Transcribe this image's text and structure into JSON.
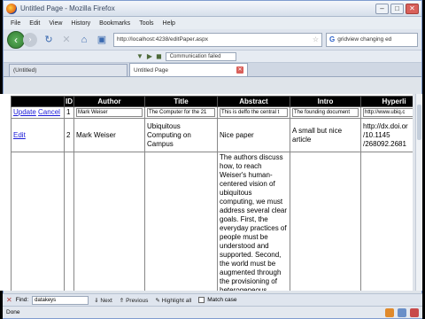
{
  "window": {
    "title": "Untitled Page - Mozilla Firefox"
  },
  "menu": [
    "File",
    "Edit",
    "View",
    "History",
    "Bookmarks",
    "Tools",
    "Help"
  ],
  "nav": {
    "url": "http://localhost:4238/editPaper.aspx",
    "search_text": "gridview changing ed",
    "status_box": "Communication failed"
  },
  "tabs": [
    {
      "label": "(Untitled)"
    },
    {
      "label": "Untitled Page"
    }
  ],
  "table": {
    "headers": [
      "",
      "ID",
      "Author",
      "Title",
      "Abstract",
      "Intro",
      "Hyperli"
    ],
    "edit_row": {
      "update_label": "Update",
      "cancel_label": "Cancel",
      "id": "1",
      "author": "Mark Weiser",
      "title": "The Computer for the 21",
      "abstract": "This is deffo the central t",
      "intro": "The founding document",
      "hyperlink": "http://www.ubiq.c"
    },
    "row2": {
      "edit_label": "Edit",
      "id": "2",
      "author": "Mark Weiser",
      "title": "Ubiquitous Computing on Campus",
      "abstract": "Nice paper",
      "intro": "A small but nice article",
      "hyperlink": "http://dx.doi.or /10.1145 /268092.2681"
    },
    "row3": {
      "abstract": "The authors discuss how, to reach Weiser's human-centered vision of ubiquitous computing, we must address several clear goals. First, the everyday practices of people must be understood and supported. Second, the world must be augmented through the provisioning of heterogeneous"
    }
  },
  "find": {
    "label": "Find:",
    "value": "datakeys",
    "next_label": "Next",
    "previous_label": "Previous",
    "highlight_label": "Highlight all",
    "matchcase_label": "Match case"
  },
  "status": {
    "text": "Done"
  }
}
